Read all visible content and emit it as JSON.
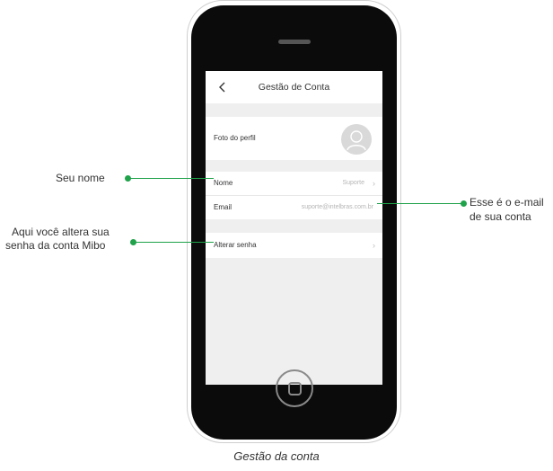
{
  "screen": {
    "title": "Gestão de Conta",
    "rows": [
      {
        "label": "Foto do perfil"
      },
      {
        "label": "Nome",
        "value": "Suporte"
      },
      {
        "label": "Email",
        "value": "suporte@intelbras.com.br"
      },
      {
        "label": "Alterar senha"
      }
    ]
  },
  "annotations": {
    "nome": "Seu nome",
    "senha_line1": "Aqui você altera sua",
    "senha_line2": "senha da conta Mibo",
    "email_line1": "Esse é o e-mail",
    "email_line2": "de sua conta"
  },
  "caption": "Gestão da conta",
  "colors": {
    "accent": "#1fa24a"
  }
}
